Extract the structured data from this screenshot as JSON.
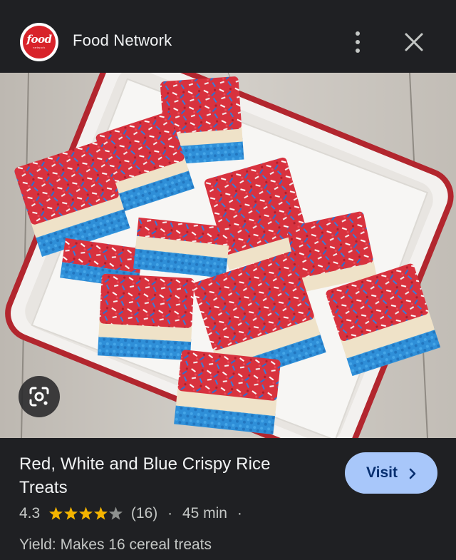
{
  "header": {
    "site_name": "Food Network",
    "logo_text": "food",
    "logo_subtext": "network",
    "more_icon": "more-vert-icon",
    "close_icon": "close-icon"
  },
  "image": {
    "lens_icon": "lens-icon"
  },
  "result": {
    "title": "Red, White and Blue Crispy Rice Treats",
    "visit_label": "Visit",
    "rating": "4.3",
    "rating_value": 4.3,
    "rating_max": 5,
    "review_count": "(16)",
    "separator": "·",
    "time": "45 min",
    "yield": "Yield: Makes 16 cereal treats"
  },
  "colors": {
    "background": "#1f2023",
    "accent": "#a8c7fa",
    "star": "#f4b400",
    "brand_red": "#d8232a"
  }
}
